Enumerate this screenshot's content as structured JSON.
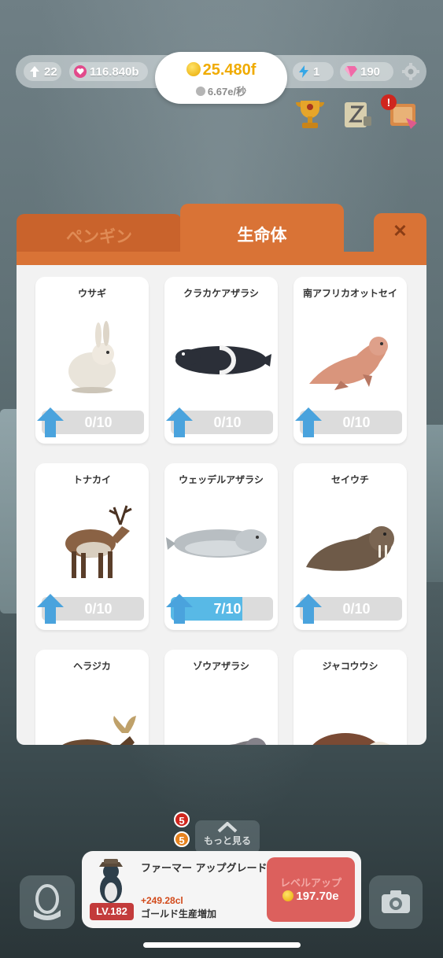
{
  "status": {
    "boost": "22",
    "hearts": "116.840b",
    "gold": "25.480f",
    "gold_rate": "6.67e/秒",
    "energy": "1",
    "gems": "190"
  },
  "tabs": [
    {
      "label": "ペンギン",
      "active": false
    },
    {
      "label": "生命体",
      "active": true
    }
  ],
  "close_label": "✕",
  "creatures": [
    {
      "name": "ウサギ",
      "progress": "0/10",
      "fill": 0
    },
    {
      "name": "クラカケアザラシ",
      "progress": "0/10",
      "fill": 0
    },
    {
      "name": "南アフリカオットセイ",
      "progress": "0/10",
      "fill": 0
    },
    {
      "name": "トナカイ",
      "progress": "0/10",
      "fill": 0
    },
    {
      "name": "ウェッデルアザラシ",
      "progress": "7/10",
      "fill": 0.7
    },
    {
      "name": "セイウチ",
      "progress": "0/10",
      "fill": 0
    },
    {
      "name": "ヘラジカ"
    },
    {
      "name": "ゾウアザラシ"
    },
    {
      "name": "ジャコウウシ"
    }
  ],
  "bottom": {
    "badge_red": "5",
    "badge_orange": "5",
    "more_label": "もっと見る",
    "upgrade_title": "ファーマー アップグレード",
    "upgrade_level": "LV.182",
    "upgrade_bonus": "+249.28cl",
    "upgrade_desc": "ゴールド生産増加",
    "levelup_label": "レベルアップ",
    "levelup_cost": "197.70e"
  },
  "colors": {
    "tab_orange": "#d97336",
    "progress_blue": "#58b9e6",
    "gold": "#f0ab00",
    "levelup_red": "#d9534f"
  }
}
